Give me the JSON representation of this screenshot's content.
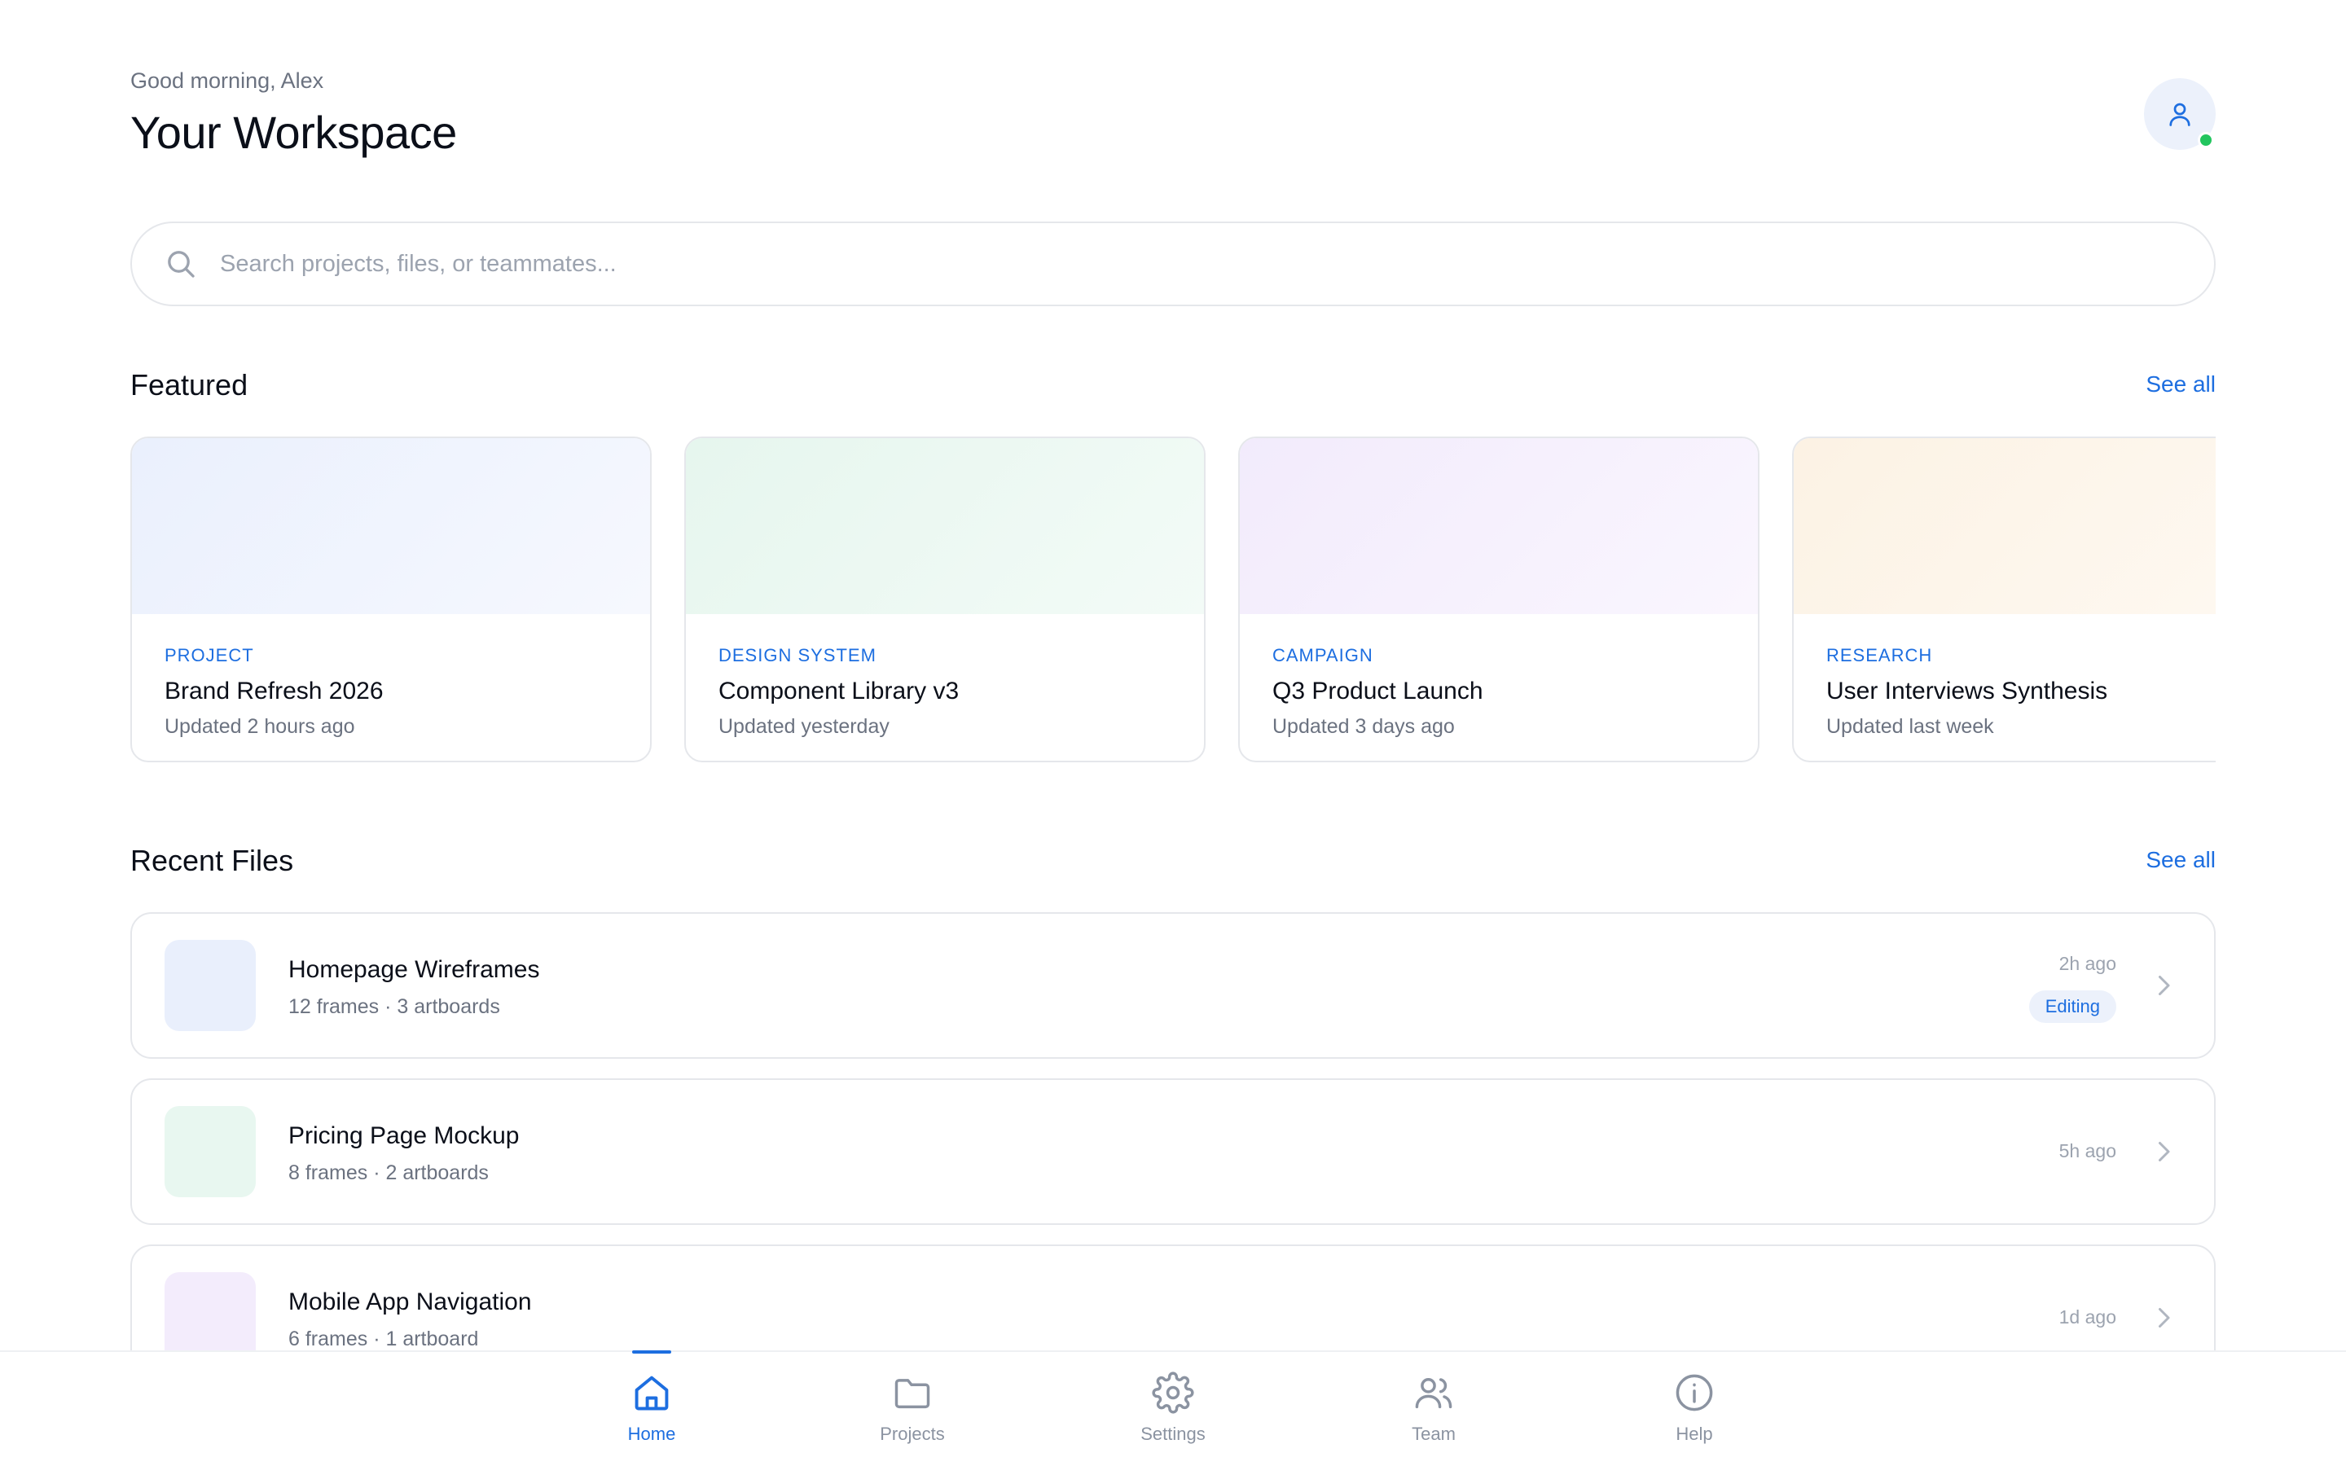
{
  "header": {
    "greeting": "Good morning, Alex",
    "title": "Your Workspace",
    "avatar_icon": "user-icon",
    "status_color": "#22c55e"
  },
  "search": {
    "placeholder": "Search projects, files, or teammates...",
    "icon": "search-icon"
  },
  "featured": {
    "title": "Featured",
    "see_all": "See all",
    "cards": [
      {
        "tag": "PROJECT",
        "name": "Brand Refresh 2026",
        "updated": "Updated 2 hours ago",
        "color": "#eef2fd"
      },
      {
        "tag": "DESIGN SYSTEM",
        "name": "Component Library v3",
        "updated": "Updated yesterday",
        "color": "#eaf7f1"
      },
      {
        "tag": "CAMPAIGN",
        "name": "Q3 Product Launch",
        "updated": "Updated 3 days ago",
        "color": "#f5effc"
      },
      {
        "tag": "RESEARCH",
        "name": "User Interviews Synthesis",
        "updated": "Updated last week",
        "color": "#fdf5ea"
      }
    ]
  },
  "recent": {
    "title": "Recent Files",
    "see_all": "See all",
    "files": [
      {
        "name": "Homepage Wireframes",
        "meta": "12 frames · 3 artboards",
        "time": "2h ago",
        "badge": "Editing",
        "color": "#e9effc"
      },
      {
        "name": "Pricing Page Mockup",
        "meta": "8 frames · 2 artboards",
        "time": "5h ago",
        "color": "#e8f7f0"
      },
      {
        "name": "Mobile App Navigation",
        "meta": "6 frames · 1 artboard",
        "time": "1d ago",
        "color": "#f3ecfc"
      }
    ]
  },
  "nav": {
    "accent": "#1d6ee0",
    "items": [
      {
        "label": "Home",
        "icon": "home-icon",
        "active": true
      },
      {
        "label": "Projects",
        "icon": "folder-icon"
      },
      {
        "label": "Settings",
        "icon": "gear-icon"
      },
      {
        "label": "Team",
        "icon": "users-icon"
      },
      {
        "label": "Help",
        "icon": "info-icon"
      }
    ]
  }
}
